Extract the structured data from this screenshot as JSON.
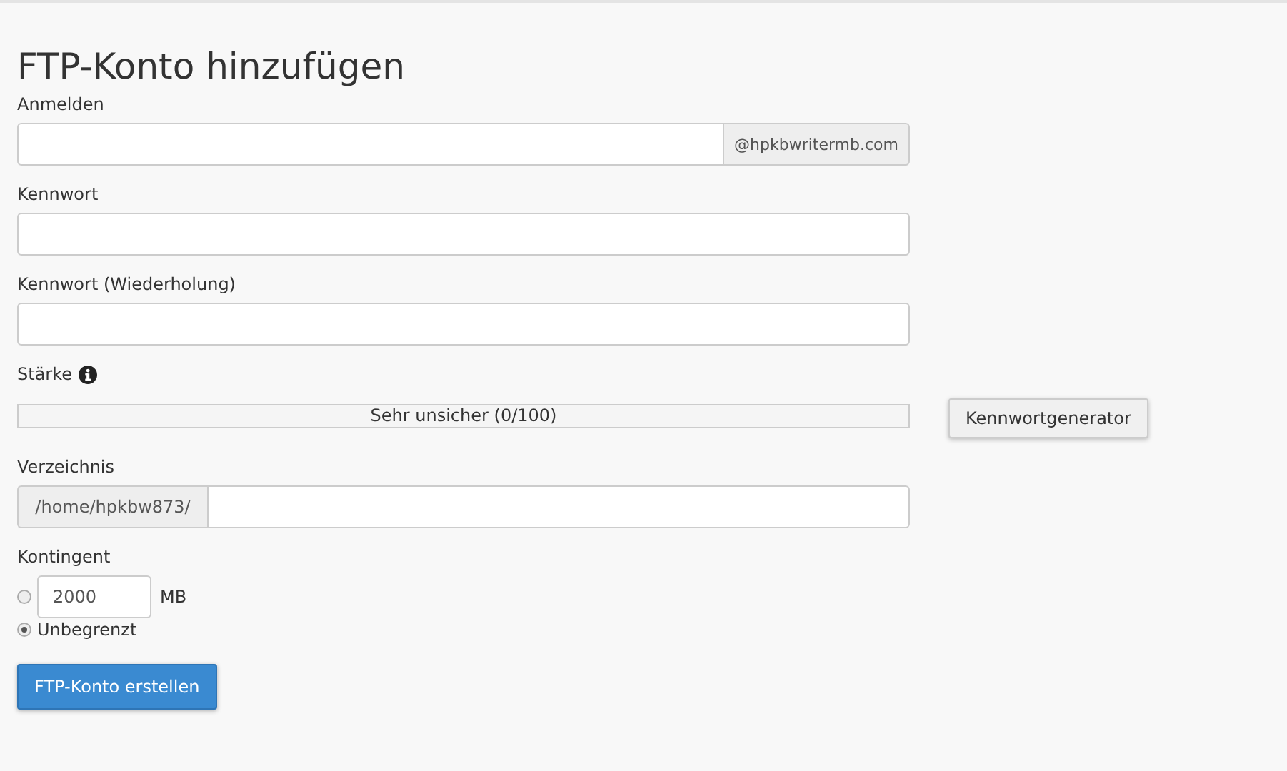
{
  "title": "FTP-Konto hinzufügen",
  "login": {
    "label": "Anmelden",
    "suffix": "@hpkbwritermb.com"
  },
  "password": {
    "label": "Kennwort"
  },
  "password_repeat": {
    "label": "Kennwort (Wiederholung)"
  },
  "strength": {
    "label": "Stärke",
    "level": 0,
    "reading": "Sehr unsicher (0/100)",
    "generator_button": "Kennwortgenerator"
  },
  "directory": {
    "label": "Verzeichnis",
    "prefix": "/home/hpkbw873/"
  },
  "quota": {
    "label": "Kontingent",
    "options": [
      {
        "kind": "limited",
        "selected": false,
        "value": "2000",
        "unit": "MB"
      },
      {
        "kind": "unlimited",
        "selected": true,
        "label": "Unbegrenzt"
      }
    ]
  },
  "submit_button": "FTP-Konto erstellen"
}
